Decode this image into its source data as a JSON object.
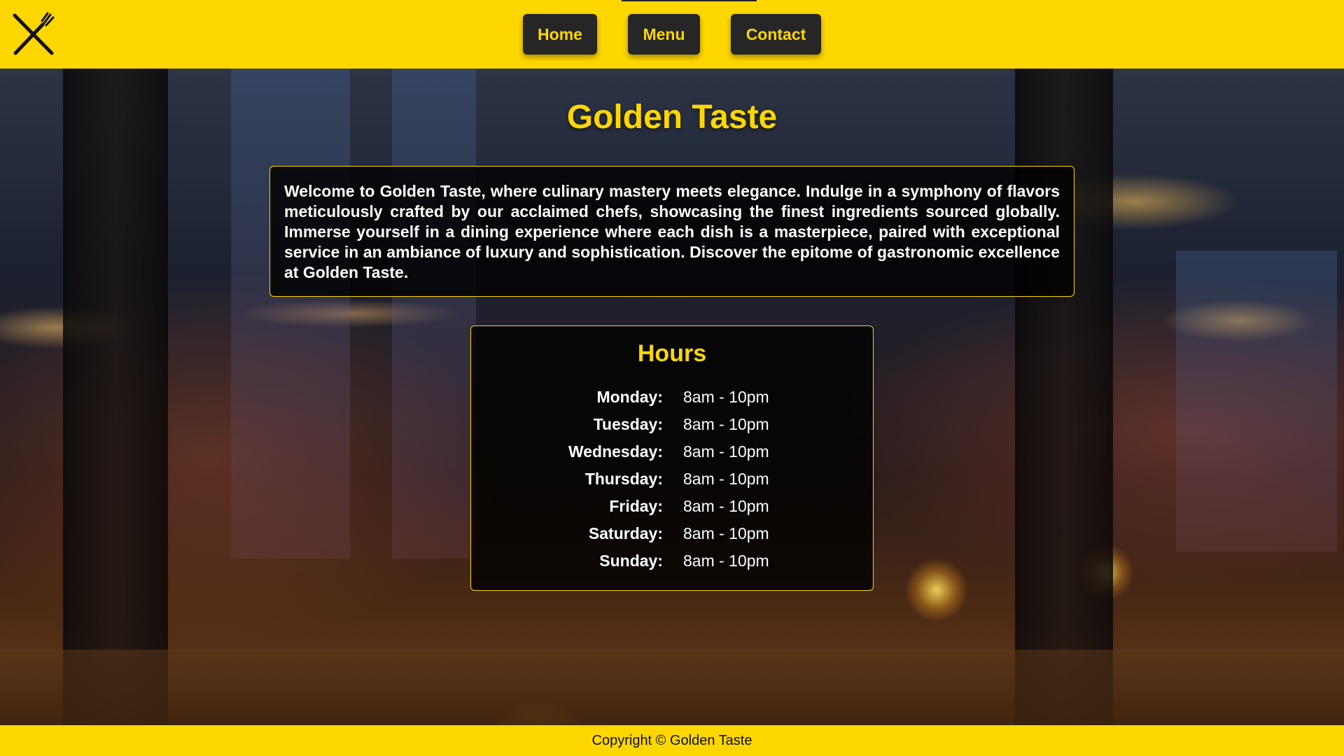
{
  "brand": {
    "logo_icon": "fork-knife-crossed-icon"
  },
  "nav": {
    "items": [
      {
        "label": "Home"
      },
      {
        "label": "Menu"
      },
      {
        "label": "Contact"
      }
    ]
  },
  "main": {
    "title": "Golden Taste",
    "intro": "Welcome to Golden Taste, where culinary mastery meets elegance. Indulge in a symphony of flavors meticulously crafted by our acclaimed chefs, showcasing the finest ingredients sourced globally. Immerse yourself in a dining experience where each dish is a masterpiece, paired with exceptional service in an ambiance of luxury and sophistication. Discover the epitome of gastronomic excellence at Golden Taste."
  },
  "hours": {
    "title": "Hours",
    "rows": [
      {
        "day": "Monday:",
        "time": "8am - 10pm"
      },
      {
        "day": "Tuesday:",
        "time": "8am - 10pm"
      },
      {
        "day": "Wednesday:",
        "time": "8am - 10pm"
      },
      {
        "day": "Thursday:",
        "time": "8am - 10pm"
      },
      {
        "day": "Friday:",
        "time": "8am - 10pm"
      },
      {
        "day": "Saturday:",
        "time": "8am - 10pm"
      },
      {
        "day": "Sunday:",
        "time": "8am - 10pm"
      }
    ]
  },
  "footer": {
    "copyright": "Copyright © Golden Taste"
  },
  "colors": {
    "accent": "#ffd700",
    "button_bg": "#262626",
    "panel_bg": "rgba(0,0,0,0.8)"
  }
}
